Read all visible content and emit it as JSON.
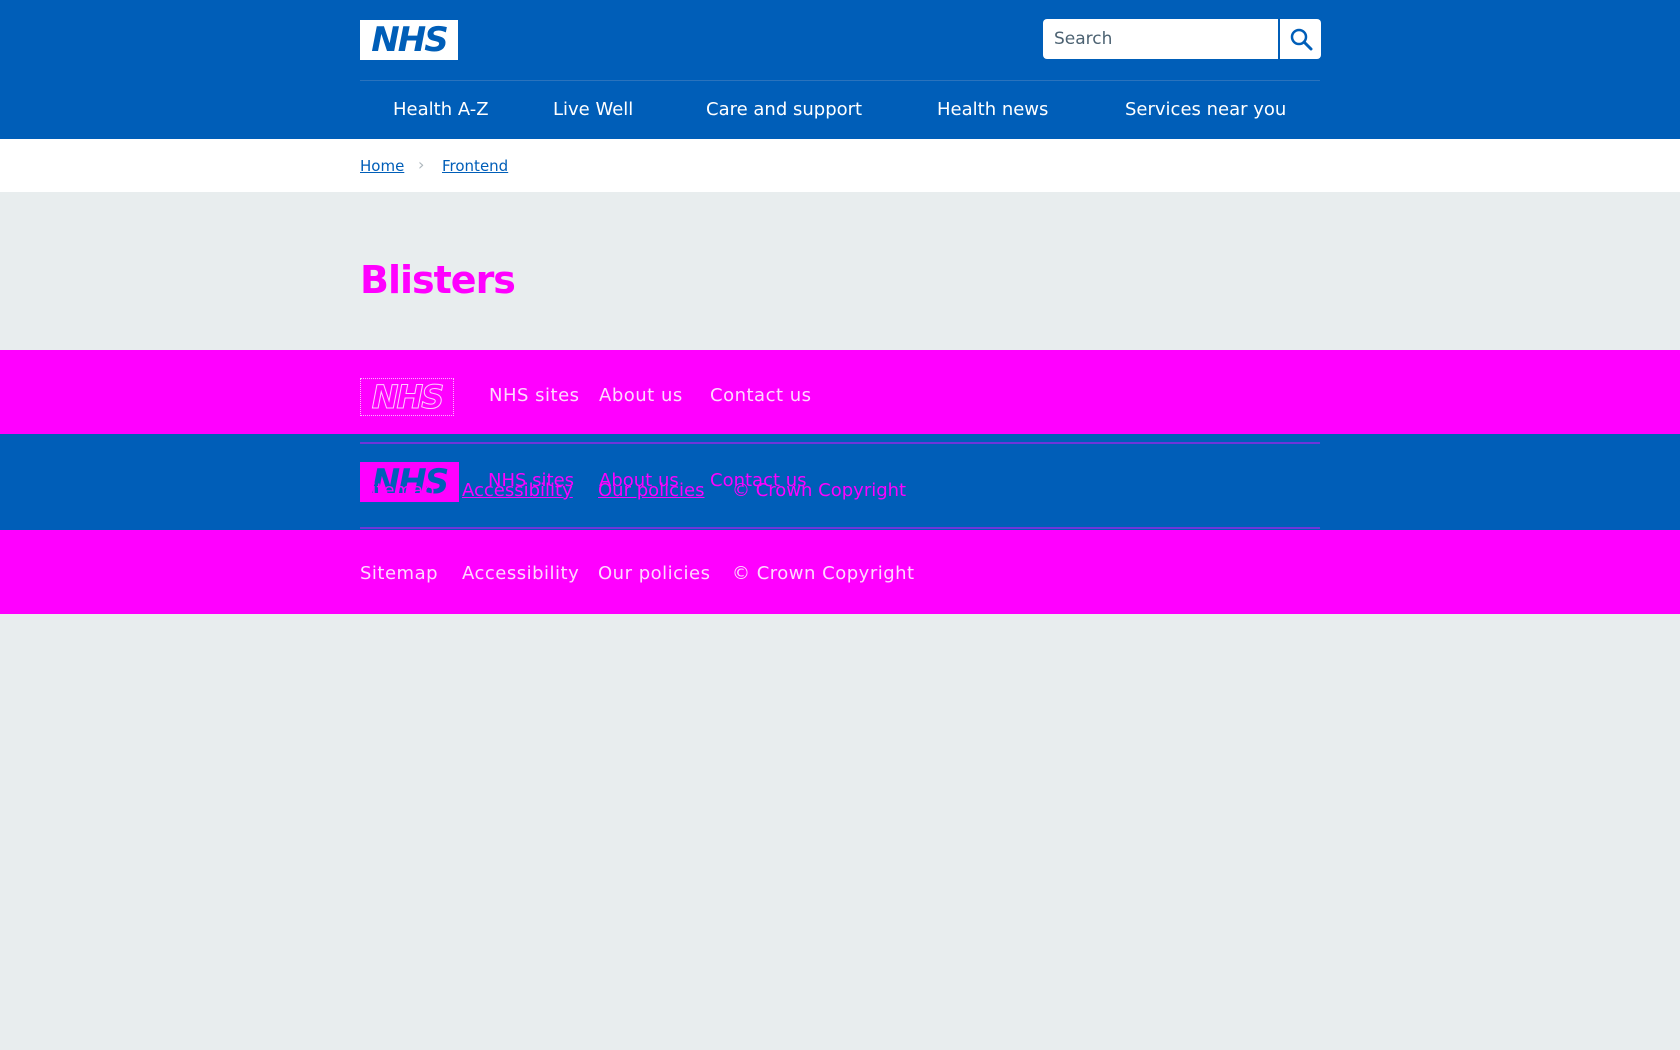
{
  "header": {
    "logo_text": "NHS",
    "search_placeholder": "Search",
    "nav": [
      {
        "label": "Health A-Z"
      },
      {
        "label": "Live Well"
      },
      {
        "label": "Care and support"
      },
      {
        "label": "Health news"
      },
      {
        "label": "Services near you"
      }
    ]
  },
  "breadcrumb": {
    "home": "Home",
    "current": "Frontend"
  },
  "page": {
    "title": "Blisters"
  },
  "footer": {
    "logo_text": "NHS",
    "primary_links": [
      "NHS sites",
      "About us",
      "Contact us"
    ],
    "secondary_links": [
      "Sitemap",
      "Accessibility",
      "Our policies"
    ],
    "copyright": "© Crown Copyright"
  },
  "colors": {
    "nhs_blue": "#005eb8",
    "accent_magenta": "#ff00ff",
    "page_background": "#e8edee"
  }
}
